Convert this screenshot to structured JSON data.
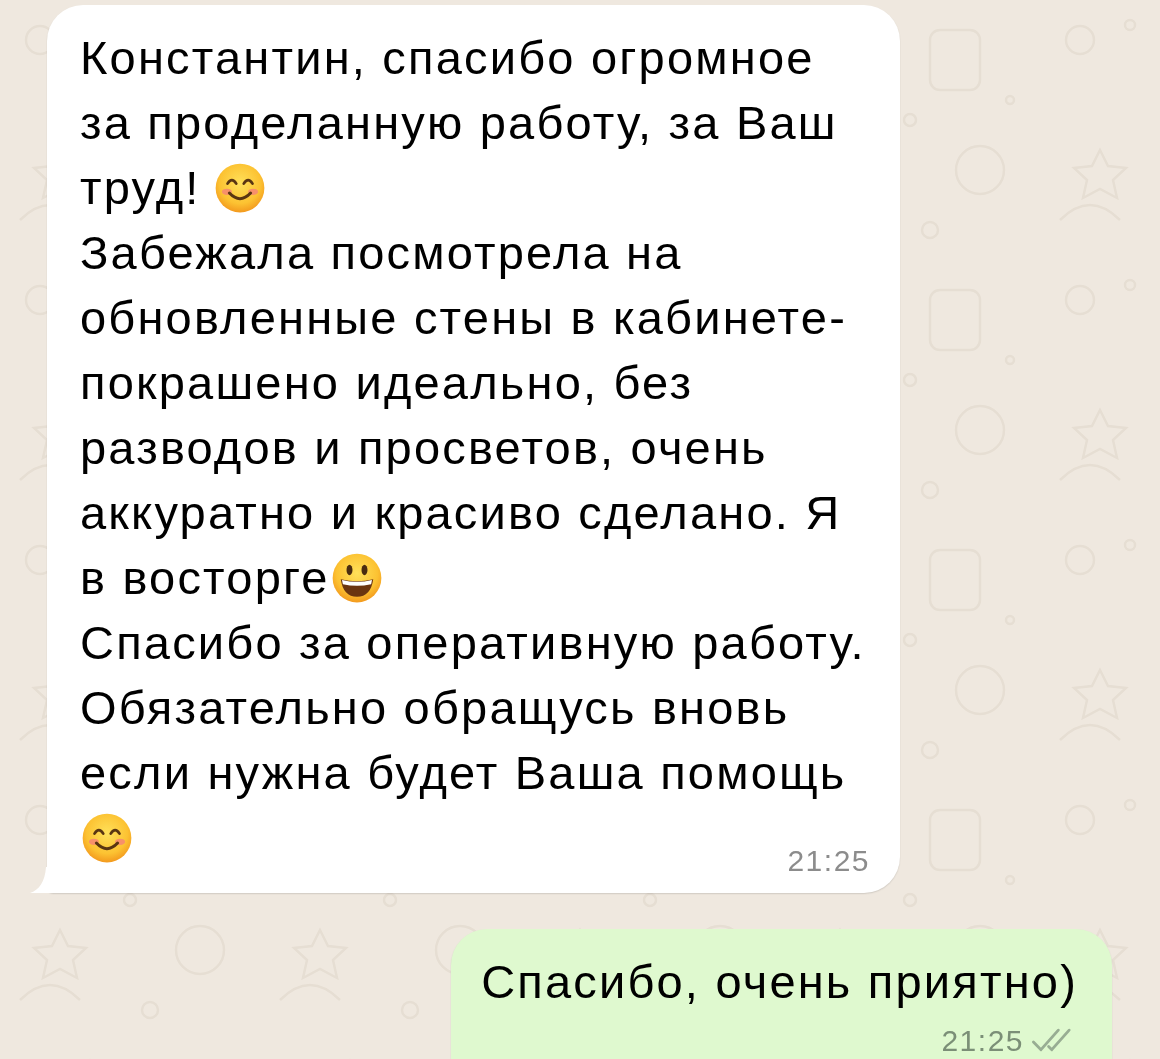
{
  "messages": [
    {
      "kind": "incoming",
      "lines": [
        [
          {
            "kind": "text",
            "text": "Константин, спасибо огромное"
          }
        ],
        [
          {
            "kind": "text",
            "text": "за проделанную работу, за Ваш"
          }
        ],
        [
          {
            "kind": "text",
            "text": "труд!"
          },
          {
            "kind": "smile",
            "spaced": true
          }
        ],
        [
          {
            "kind": "text",
            "text": "Забежала посмотрела на"
          }
        ],
        [
          {
            "kind": "text",
            "text": "обновленные стены в кабинете-"
          }
        ],
        [
          {
            "kind": "text",
            "text": "покрашено идеально, без"
          }
        ],
        [
          {
            "kind": "text",
            "text": "разводов и просветов, очень"
          }
        ],
        [
          {
            "kind": "text",
            "text": "аккуратно и красиво сделано. Я"
          }
        ],
        [
          {
            "kind": "text",
            "text": "в восторге"
          },
          {
            "kind": "grin"
          }
        ],
        [
          {
            "kind": "text",
            "text": "Спасибо за оперативную работу."
          }
        ],
        [
          {
            "kind": "text",
            "text": "Обязательно обращусь вновь"
          }
        ],
        [
          {
            "kind": "text",
            "text": "если нужна будет Ваша помощь"
          }
        ],
        [
          {
            "kind": "smile"
          }
        ]
      ],
      "time": "21:25"
    },
    {
      "kind": "outgoing",
      "lines": [
        [
          {
            "kind": "text",
            "text": "Спасибо, очень приятно)"
          }
        ]
      ],
      "time": "21:25",
      "read": false
    }
  ]
}
